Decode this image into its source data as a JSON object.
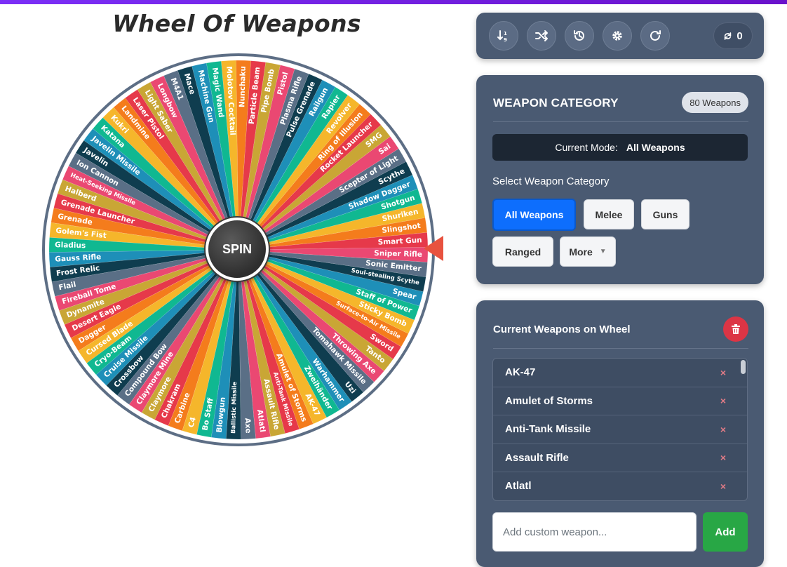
{
  "app": {
    "title": "Wheel Of Weapons",
    "accent": "#6a11cb"
  },
  "wheel": {
    "spin_label": "SPIN",
    "colors": [
      "#e6394a",
      "#f47c1c",
      "#f5b62b",
      "#10b891",
      "#1e8fb8",
      "#0f3d4f",
      "#5a6f86",
      "#ea4872",
      "#c9a635"
    ],
    "weapons": [
      "Smart Gun",
      "Slingshot",
      "Shuriken",
      "Shotgun",
      "Shadow Dagger",
      "Scythe",
      "Scepter of Light",
      "Sai",
      "SMG",
      "Rocket Launcher",
      "Ring of Illusion",
      "Revolver",
      "Rapier",
      "Railgun",
      "Pulse Grenade",
      "Plasma Rifle",
      "Pistol",
      "Pipe Bomb",
      "Particle Beam",
      "Nunchaku",
      "Molotov Cocktail",
      "Magic Wand",
      "Machine Gun",
      "Mace",
      "M4A1",
      "Longbow",
      "Light Saber",
      "Laser Pistol",
      "Landmine",
      "Kukri",
      "Katana",
      "Javelin Missile",
      "Javelin",
      "Ion Cannon",
      "Heat-Seeking Missile",
      "Halberd",
      "Grenade Launcher",
      "Grenade",
      "Golem's Fist",
      "Gladius",
      "Gauss Rifle",
      "Frost Relic",
      "Flail",
      "Fireball Tome",
      "Dynamite",
      "Desert Eagle",
      "Dagger",
      "Cursed Blade",
      "Cryo-Beam",
      "Cruise Missile",
      "Crossbow",
      "Compound Bow",
      "Claymore Mine",
      "Claymore",
      "Chakram",
      "Carbine",
      "C4",
      "Bo Staff",
      "Blowgun",
      "Ballistic Missile",
      "Axe",
      "Atlatl",
      "Assault Rifle",
      "Anti-Tank Missile",
      "Amulet of Storms",
      "AK-47",
      "Zweihänder",
      "Warhammer",
      "Uzi",
      "Tomahawk Missile",
      "Throwing Axe",
      "Tanto",
      "Sword",
      "Surface-to-Air Missile",
      "Sticky Bomb",
      "Staff of Power",
      "Spear",
      "Soul-stealing Scythe",
      "Sonic Emitter",
      "Sniper Rifle"
    ]
  },
  "toolbar": {
    "buttons": [
      {
        "name": "sort-button",
        "icon": "sort-numeric-icon"
      },
      {
        "name": "shuffle-button",
        "icon": "shuffle-icon"
      },
      {
        "name": "history-button",
        "icon": "history-icon"
      },
      {
        "name": "settings-button",
        "icon": "gear-icon"
      },
      {
        "name": "reset-button",
        "icon": "redo-icon"
      }
    ],
    "spin_count": "0"
  },
  "category": {
    "title": "WEAPON CATEGORY",
    "count_badge": "80 Weapons",
    "mode_label": "Current Mode:",
    "mode_value": "All Weapons",
    "select_label": "Select Weapon Category",
    "buttons": {
      "all": "All Weapons",
      "melee": "Melee",
      "guns": "Guns",
      "ranged": "Ranged",
      "more": "More"
    }
  },
  "current": {
    "title": "Current Weapons on Wheel",
    "items": [
      "AK-47",
      "Amulet of Storms",
      "Anti-Tank Missile",
      "Assault Rifle",
      "Atlatl"
    ],
    "remove_glyph": "×",
    "input_placeholder": "Add custom weapon...",
    "add_label": "Add"
  }
}
